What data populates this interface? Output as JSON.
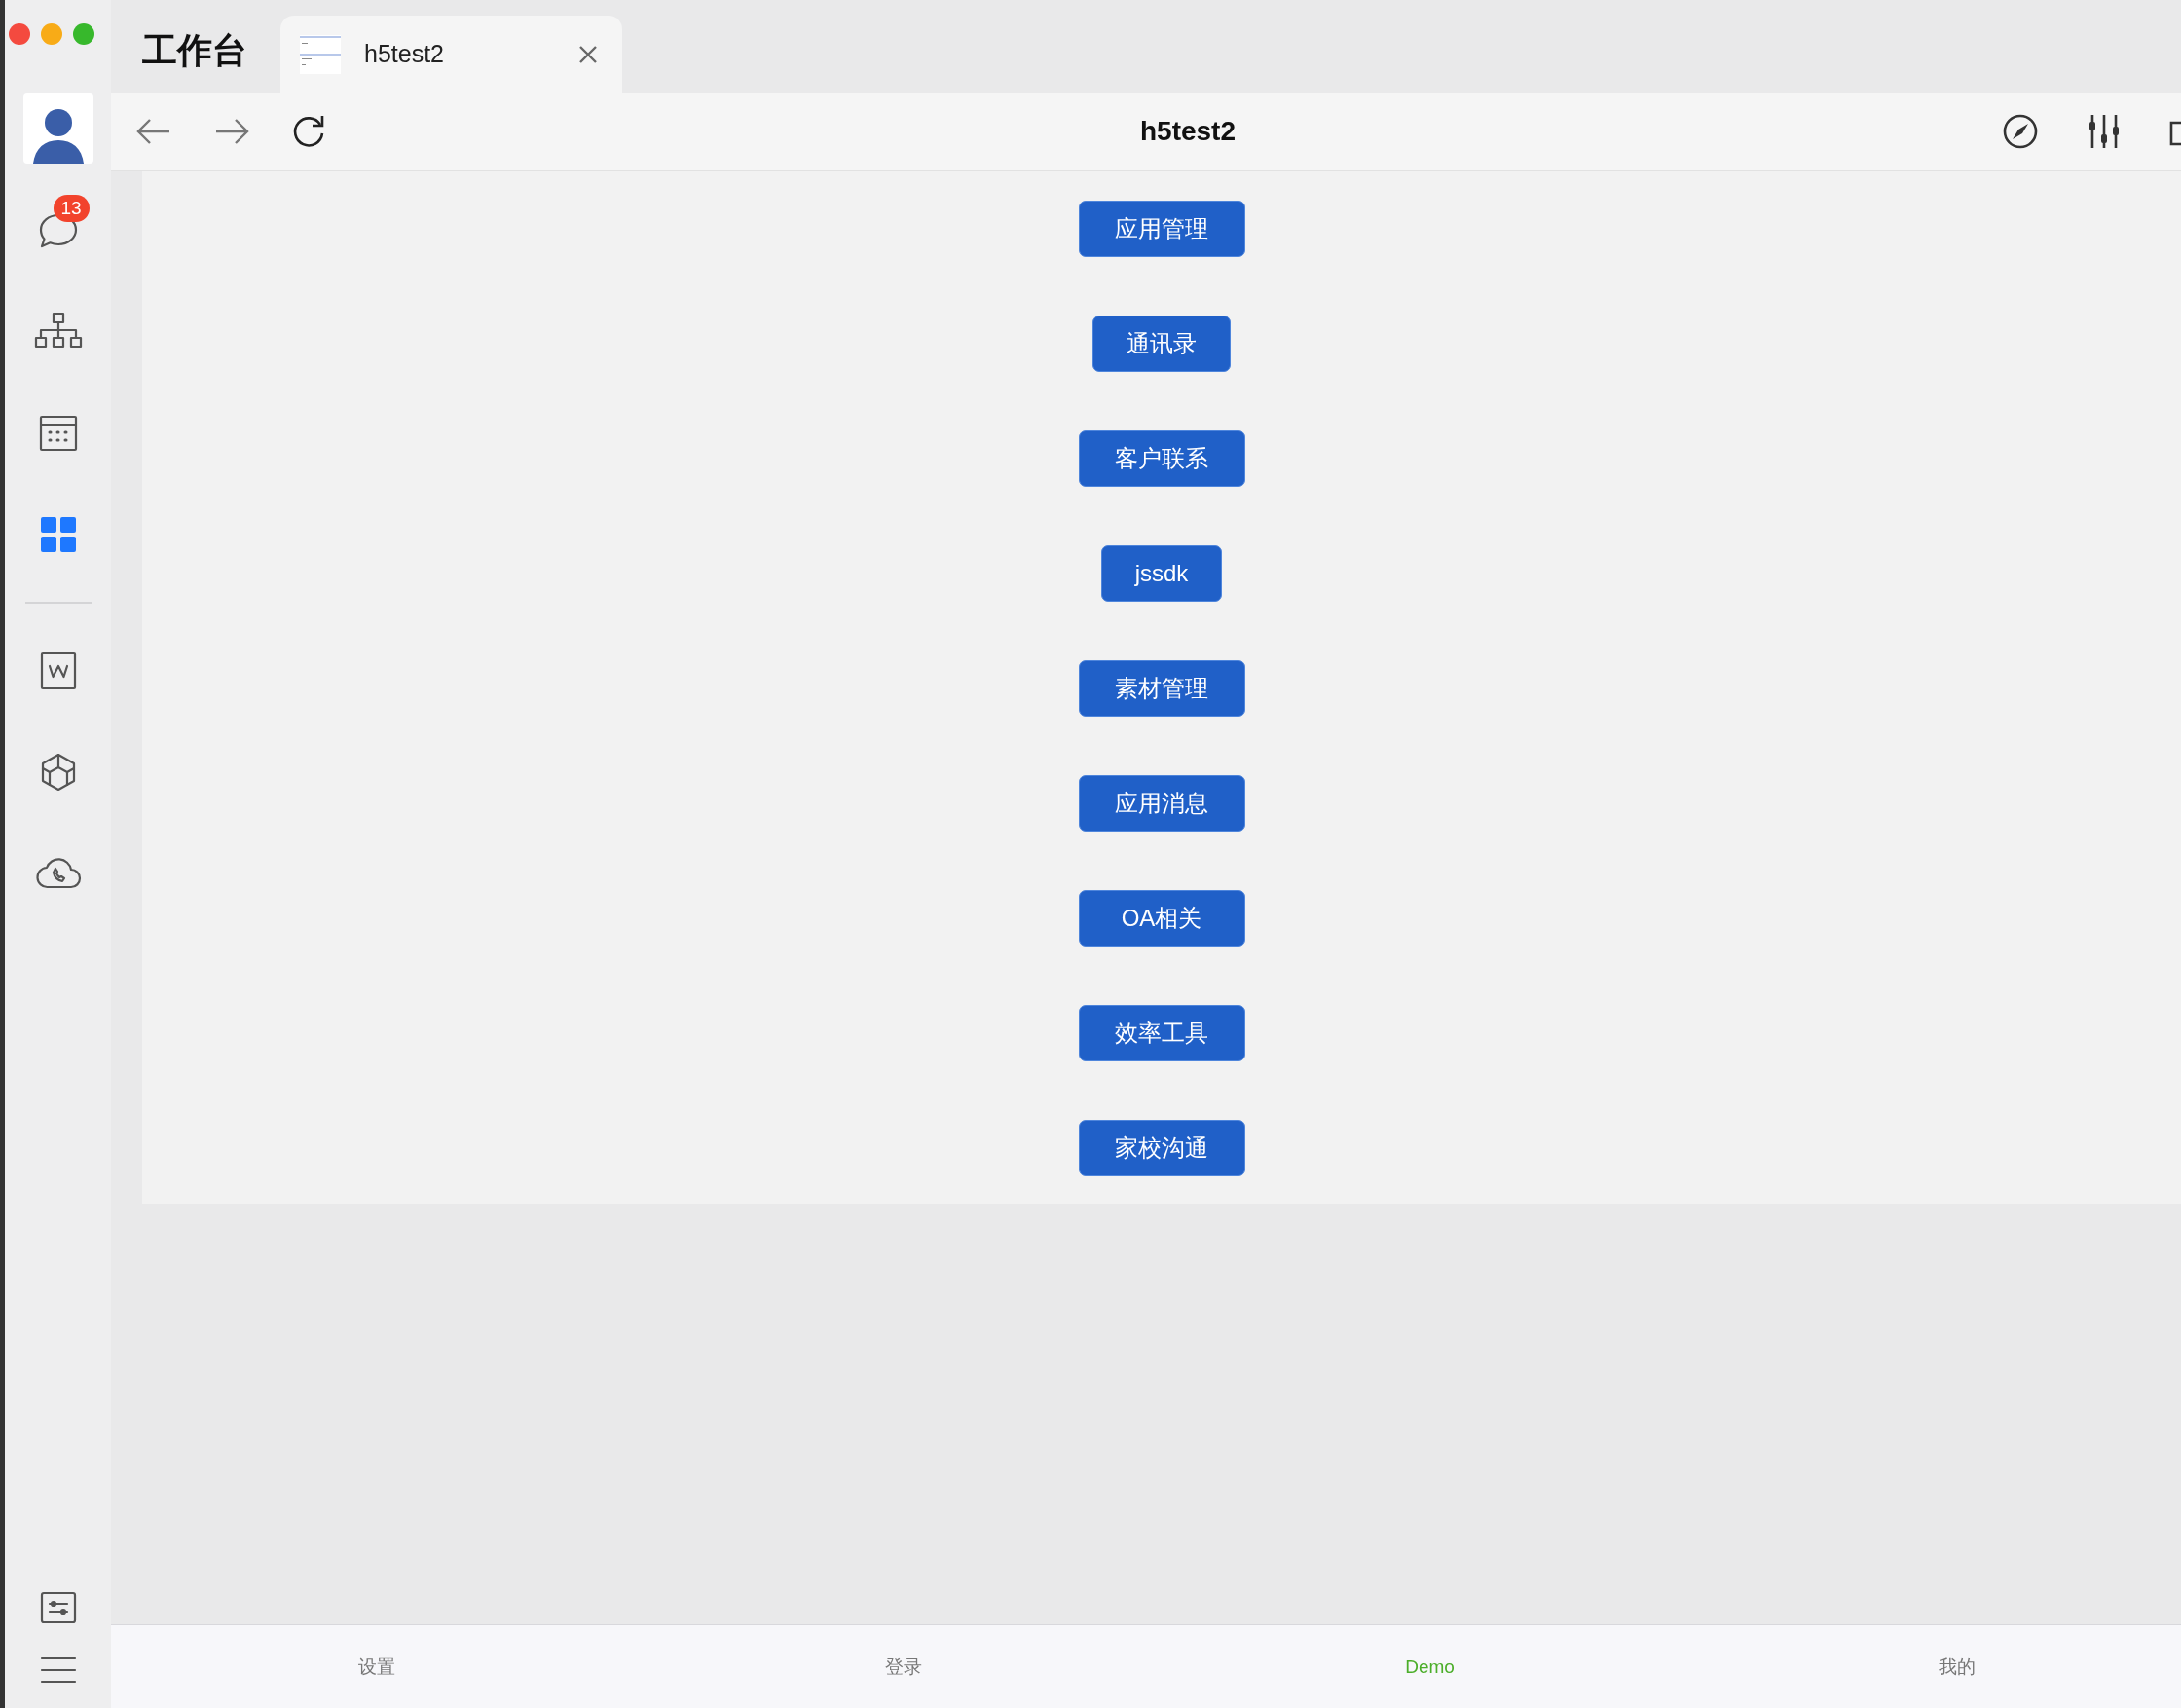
{
  "workspace_title": "工作台",
  "tab": {
    "title": "h5test2"
  },
  "sidebar": {
    "items": [
      {
        "kind": "chat",
        "badge": "13",
        "selected": false
      },
      {
        "kind": "org",
        "selected": false
      },
      {
        "kind": "calendar",
        "selected": false
      },
      {
        "kind": "apps",
        "selected": true
      },
      {
        "kind": "doc",
        "selected": false
      },
      {
        "kind": "cube",
        "selected": false
      },
      {
        "kind": "cloud",
        "selected": false
      }
    ],
    "footer": [
      {
        "kind": "panel"
      },
      {
        "kind": "menu"
      }
    ]
  },
  "toolbar": {
    "title": "h5test2"
  },
  "buttons": [
    "应用管理",
    "通讯录",
    "客户联系",
    "jssdk",
    "素材管理",
    "应用消息",
    "OA相关",
    "效率工具",
    "家校沟通"
  ],
  "bottom_tabs": [
    {
      "label": "设置",
      "selected": false
    },
    {
      "label": "登录",
      "selected": false
    },
    {
      "label": "Demo",
      "selected": true
    },
    {
      "label": "我的",
      "selected": false
    }
  ]
}
